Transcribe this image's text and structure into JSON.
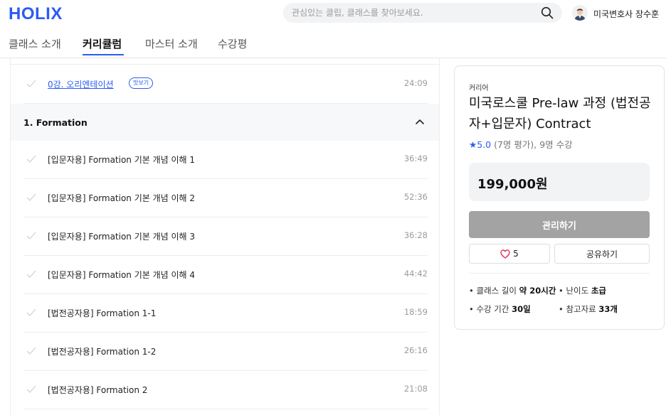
{
  "header": {
    "logo": "HOLIX",
    "search_placeholder": "관심있는 클립, 클래스를 찾아보세요.",
    "user_name": "미국변호사 장수훈"
  },
  "tabs": [
    {
      "label": "클래스 소개",
      "active": false
    },
    {
      "label": "커리큘럼",
      "active": true
    },
    {
      "label": "마스터 소개",
      "active": false
    },
    {
      "label": "수강평",
      "active": false
    }
  ],
  "curriculum": {
    "intro_lesson": {
      "title": "0강. 오리엔테이션",
      "badge": "맛보기",
      "duration": "24:09"
    },
    "section": {
      "title": "1. Formation"
    },
    "lessons": [
      {
        "title": "[입문자용] Formation 기본 개념 이해 1",
        "duration": "36:49"
      },
      {
        "title": "[입문자용] Formation 기본 개념 이해 2",
        "duration": "52:36"
      },
      {
        "title": "[입문자용] Formation 기본 개념 이해 3",
        "duration": "36:28"
      },
      {
        "title": "[입문자용] Formation 기본 개념 이해 4",
        "duration": "44:42"
      },
      {
        "title": "[법전공자용] Formation 1-1",
        "duration": "18:59"
      },
      {
        "title": "[법전공자용] Formation 1-2",
        "duration": "26:16"
      },
      {
        "title": "[법전공자용] Formation 2",
        "duration": "21:08"
      }
    ]
  },
  "card": {
    "category": "커리어",
    "title": "미국로스쿨 Pre-law 과정 (법전공자+입문자) Contract",
    "rating": "5.0",
    "rating_detail": "(7명 평가), 9명 수강",
    "price": "199,000원",
    "manage_label": "관리하기",
    "like_count": "5",
    "share_label": "공유하기",
    "info": {
      "length_label": "• 클래스 길이 ",
      "length_value": "약 20시간",
      "level_label": "• 난이도 ",
      "level_value": "초급",
      "period_label": "• 수강 기간 ",
      "period_value": "30일",
      "materials_label": "• 참고자료 ",
      "materials_value": "33개"
    }
  },
  "colors": {
    "accent": "#2b5bf5",
    "heart": "#e0395a",
    "disabled_button": "#a3a3a3"
  }
}
